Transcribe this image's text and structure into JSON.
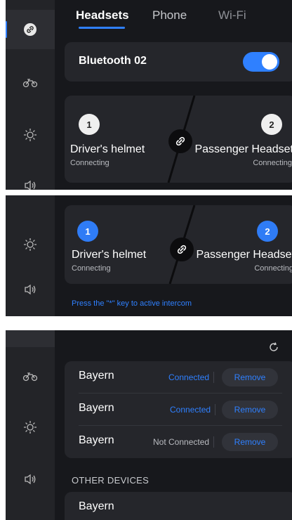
{
  "colors": {
    "accent": "#2f80ff",
    "panel_bg": "#17181c",
    "sidebar_bg": "#232428",
    "card_bg": "#25262b"
  },
  "screen1": {
    "tabs": [
      {
        "label": "Headsets",
        "active": true
      },
      {
        "label": "Phone",
        "active": false
      },
      {
        "label": "Wi-Fi",
        "active": false
      }
    ],
    "sidebar_icons": [
      "link-icon",
      "motorcycle-icon",
      "brightness-icon",
      "volume-icon"
    ],
    "device_label": "Bluetooth 02",
    "toggle_on": true,
    "driver": {
      "badge": "1",
      "name": "Driver's helmet",
      "status": "Connecting"
    },
    "passenger": {
      "badge": "2",
      "name": "Passenger Headset",
      "status": "Connecting"
    }
  },
  "screen2": {
    "sidebar_icons": [
      "brightness-icon",
      "volume-icon"
    ],
    "driver": {
      "badge": "1",
      "name": "Driver's helmet",
      "status": "Connecting"
    },
    "passenger": {
      "badge": "2",
      "name": "Passenger Headset",
      "status": "Connecting"
    },
    "hint": "Press the \"*\" key to active intercom"
  },
  "screen3": {
    "sidebar_icons": [
      "motorcycle-icon",
      "brightness-icon",
      "volume-icon"
    ],
    "paired_devices": [
      {
        "name": "Bayern",
        "status": "Connected",
        "connected": true,
        "action": "Remove"
      },
      {
        "name": "Bayern",
        "status": "Connected",
        "connected": true,
        "action": "Remove"
      },
      {
        "name": "Bayern",
        "status": "Not Connected",
        "connected": false,
        "action": "Remove"
      }
    ],
    "other_devices_title": "OTHER DEVICES",
    "other_devices": [
      {
        "name": "Bayern"
      }
    ]
  }
}
